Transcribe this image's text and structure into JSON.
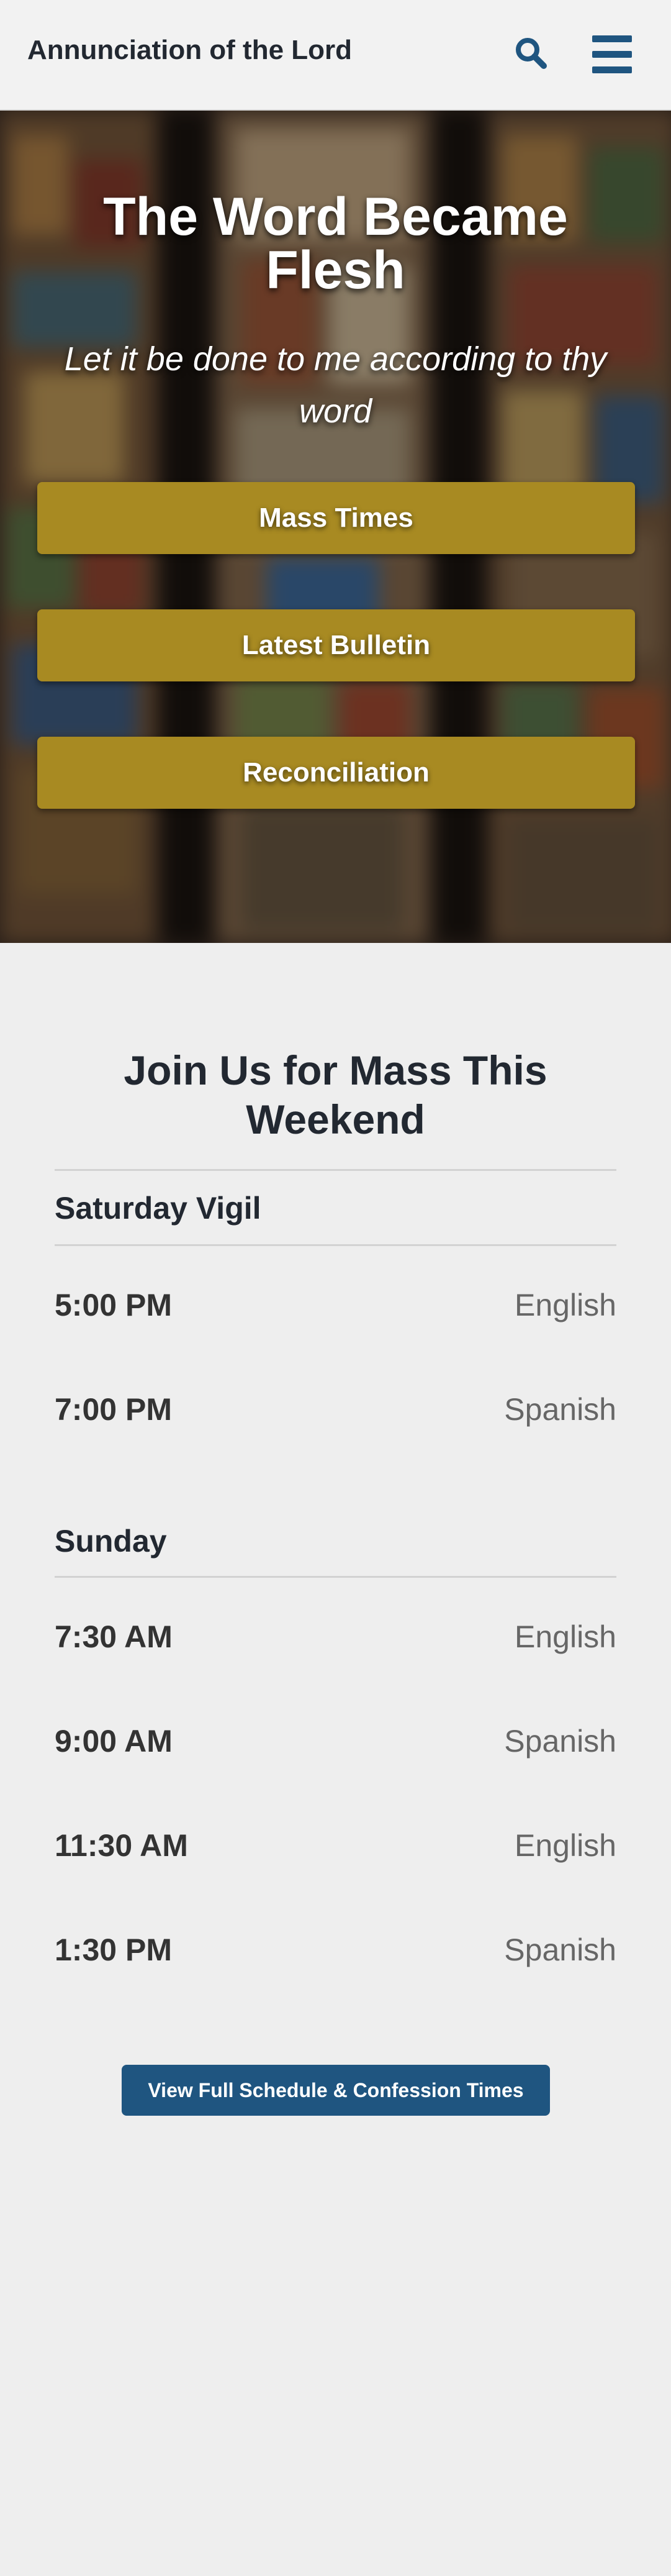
{
  "header": {
    "site_title": "Annunciation of the Lord",
    "search_icon": "search-icon",
    "menu_icon": "hamburger-menu-icon",
    "accent_color": "#1f5580"
  },
  "hero": {
    "title": "The Word Became Flesh",
    "subtitle": "Let it be done to me according to thy word",
    "background": "blurred stained glass window",
    "button_color": "#a88a22",
    "buttons": [
      {
        "label": "Mass Times"
      },
      {
        "label": "Latest Bulletin"
      },
      {
        "label": "Reconciliation"
      }
    ]
  },
  "mass": {
    "title": "Join Us for Mass This Weekend",
    "groups": [
      {
        "heading": "Saturday Vigil",
        "times": [
          {
            "time": "5:00 PM",
            "language": "English"
          },
          {
            "time": "7:00 PM",
            "language": "Spanish"
          }
        ]
      },
      {
        "heading": "Sunday",
        "times": [
          {
            "time": "7:30 AM",
            "language": "English"
          },
          {
            "time": "9:00 AM",
            "language": "Spanish"
          },
          {
            "time": "11:30 AM",
            "language": "English"
          },
          {
            "time": "1:30 PM",
            "language": "Spanish"
          }
        ]
      }
    ],
    "schedule_button": "View Full Schedule & Confession Times"
  }
}
